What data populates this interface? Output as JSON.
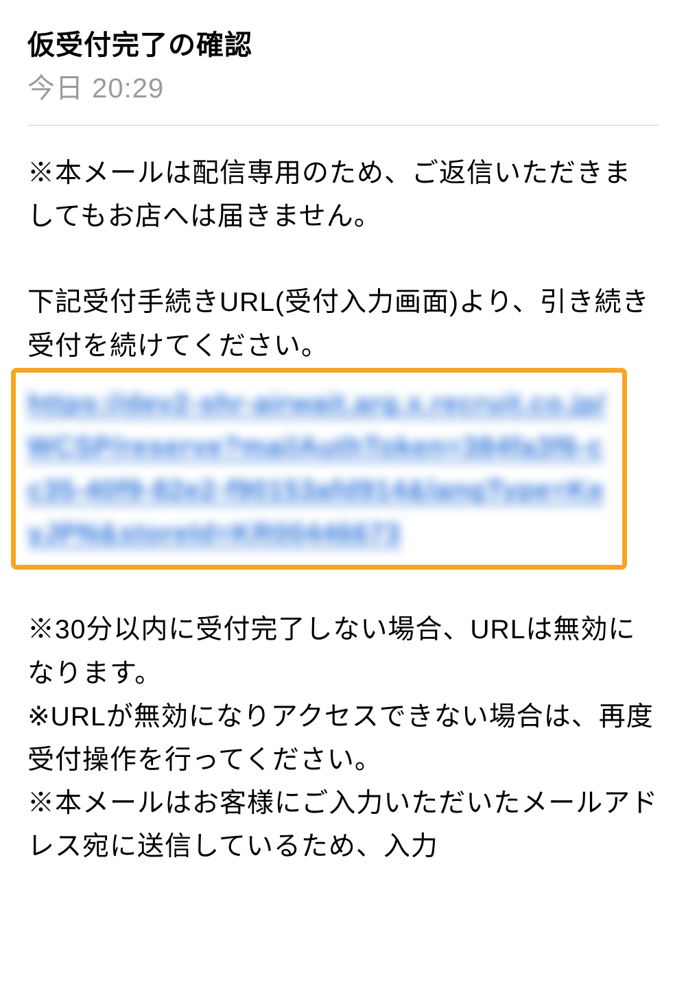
{
  "header": {
    "subject": "仮受付完了の確認",
    "timestamp": "今日 20:29"
  },
  "body": {
    "para1": "※本メールは配信専用のため、ご返信いただきましてもお店へは届きません。",
    "para2": "下記受付手続きURL(受付入力画面)より、引き続き受付を続けてください。",
    "link_text": "https://dev2-shr-airwait.arg.x.recruit.co.jp/WCSP/reserve?mailAuthToken=384fa3f6-cc35-40f9-82e2-f90153afd914&langType=KeyJPN&storeId=KR00446673",
    "para3_line1": "※30分以内に受付完了しない場合、URLは無効になります。",
    "para3_line2": "※URLが無効になりアクセスできない場合は、再度受付操作を行ってください。",
    "para3_line3": "※本メールはお客様にご入力いただいたメールアドレス宛に送信しているため、入力"
  },
  "colors": {
    "highlight_border": "#f5a623",
    "link_color": "#2f75d9",
    "timestamp_gray": "#9a9a9a"
  }
}
